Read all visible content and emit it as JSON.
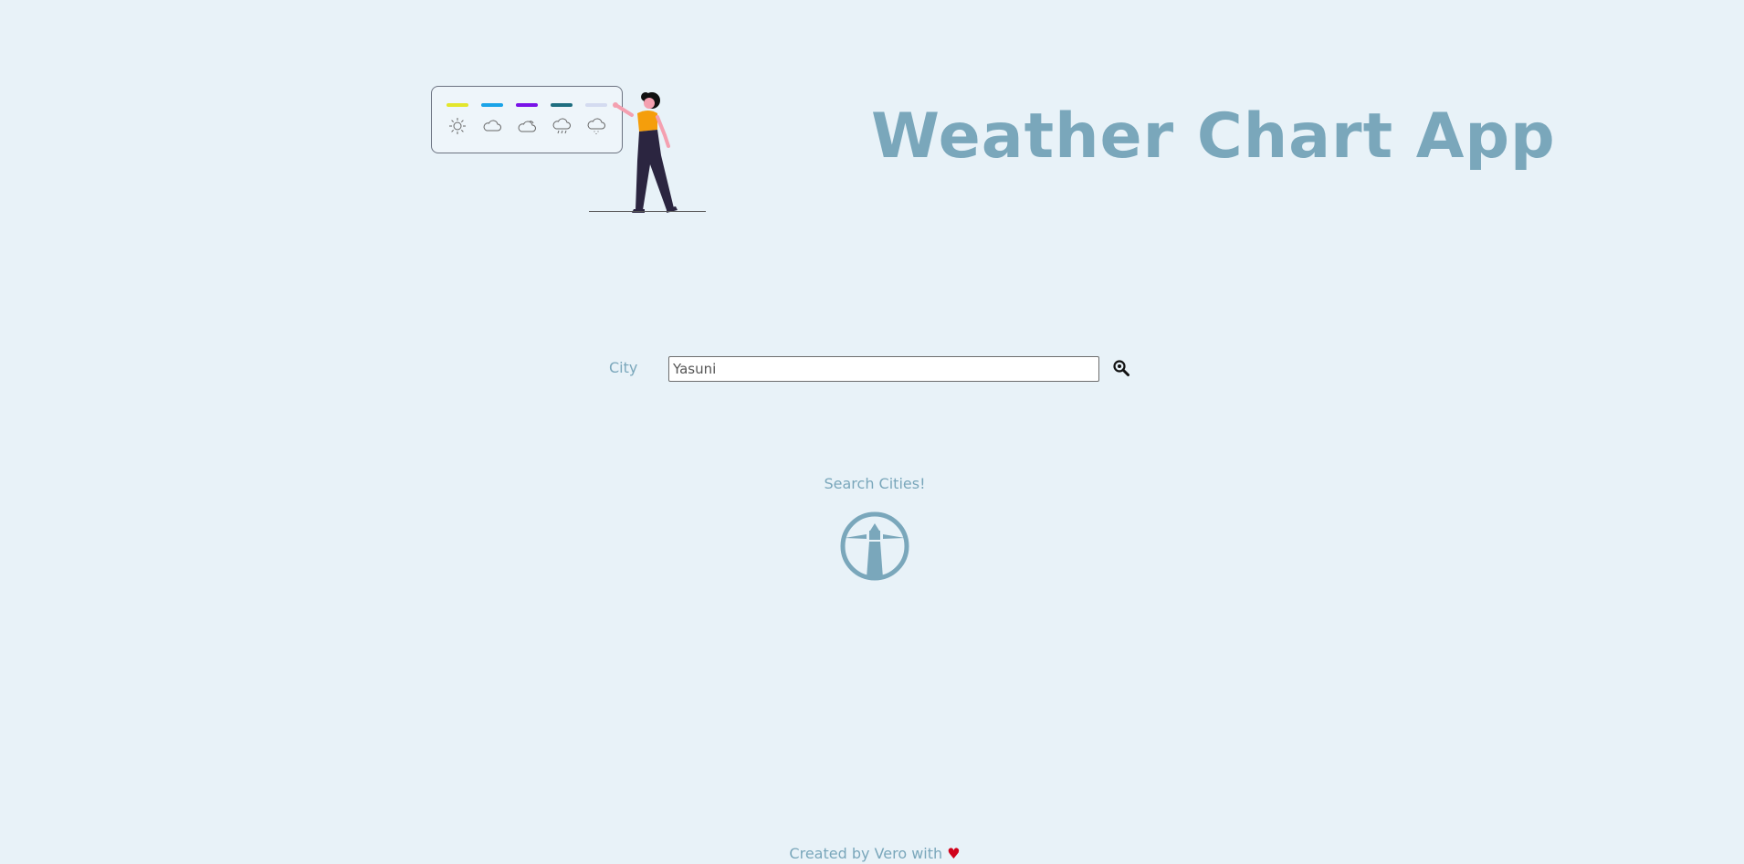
{
  "header": {
    "title": "Weather Chart App"
  },
  "illustration": {
    "swatch_colors": [
      "#e3e62c",
      "#1aa3e8",
      "#7a12e8",
      "#1f6e80",
      "#d4dbf0"
    ],
    "icons": [
      "sun-icon",
      "cloud-icon",
      "cloud-sun-icon",
      "rain-cloud-icon",
      "drizzle-cloud-icon"
    ]
  },
  "search": {
    "label": "City",
    "value": "Yasuni",
    "button_icon": "magnifier-icon"
  },
  "main": {
    "message": "Search Cities!",
    "icon": "lighthouse-icon"
  },
  "footer": {
    "text": "Created by Vero with",
    "heart": "♥"
  },
  "colors": {
    "background": "#e8f2f8",
    "accent": "#7aa7bb",
    "heart": "#d0021b"
  }
}
